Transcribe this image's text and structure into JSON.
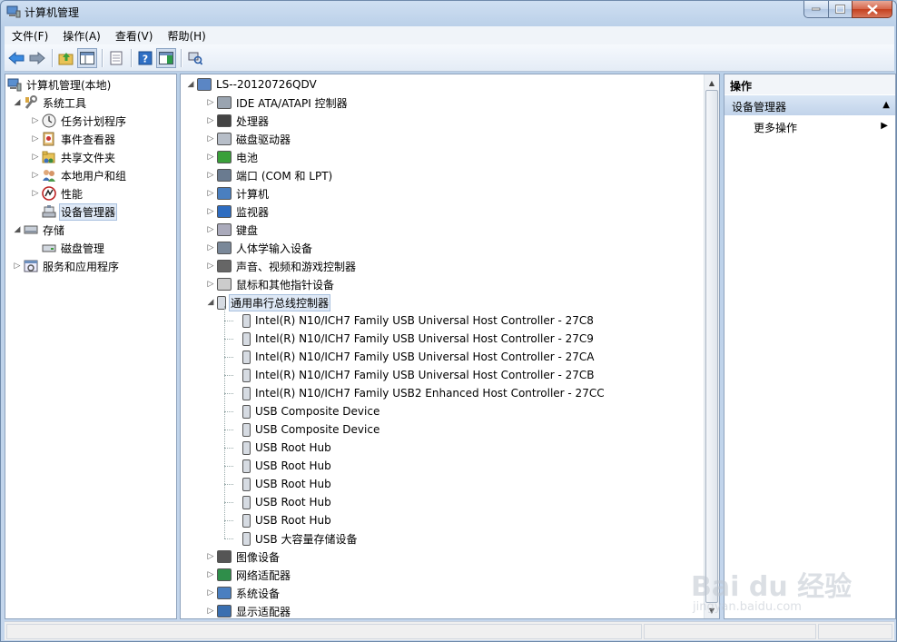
{
  "window": {
    "title": "计算机管理"
  },
  "menu": [
    {
      "label": "文件(F)"
    },
    {
      "label": "操作(A)"
    },
    {
      "label": "查看(V)"
    },
    {
      "label": "帮助(H)"
    }
  ],
  "left_tree": {
    "root": "计算机管理(本地)",
    "system_tools": "系统工具",
    "task_scheduler": "任务计划程序",
    "event_viewer": "事件查看器",
    "shared_folders": "共享文件夹",
    "local_users": "本地用户和组",
    "performance": "性能",
    "device_manager": "设备管理器",
    "storage": "存储",
    "disk_management": "磁盘管理",
    "services_apps": "服务和应用程序"
  },
  "device_tree": {
    "computer": "LS--20120726QDV",
    "categories": [
      {
        "label": "IDE ATA/ATAPI 控制器",
        "icon": "ide-controller-icon"
      },
      {
        "label": "处理器",
        "icon": "processor-icon"
      },
      {
        "label": "磁盘驱动器",
        "icon": "disk-drive-icon"
      },
      {
        "label": "电池",
        "icon": "battery-icon"
      },
      {
        "label": "端口 (COM 和 LPT)",
        "icon": "port-icon"
      },
      {
        "label": "计算机",
        "icon": "computer-icon"
      },
      {
        "label": "监视器",
        "icon": "monitor-icon"
      },
      {
        "label": "键盘",
        "icon": "keyboard-icon"
      },
      {
        "label": "人体学输入设备",
        "icon": "hid-icon"
      },
      {
        "label": "声音、视频和游戏控制器",
        "icon": "sound-icon"
      },
      {
        "label": "鼠标和其他指针设备",
        "icon": "mouse-icon"
      }
    ],
    "usb_category": "通用串行总线控制器",
    "usb_devices": [
      "Intel(R) N10/ICH7 Family USB Universal Host Controller - 27C8",
      "Intel(R) N10/ICH7 Family USB Universal Host Controller - 27C9",
      "Intel(R) N10/ICH7 Family USB Universal Host Controller - 27CA",
      "Intel(R) N10/ICH7 Family USB Universal Host Controller - 27CB",
      "Intel(R) N10/ICH7 Family USB2 Enhanced Host Controller - 27CC",
      "USB Composite Device",
      "USB Composite Device",
      "USB Root Hub",
      "USB Root Hub",
      "USB Root Hub",
      "USB Root Hub",
      "USB Root Hub",
      "USB 大容量存储设备"
    ],
    "after_categories": [
      {
        "label": "图像设备",
        "icon": "imaging-icon"
      },
      {
        "label": "网络适配器",
        "icon": "network-adapter-icon"
      },
      {
        "label": "系统设备",
        "icon": "system-device-icon"
      },
      {
        "label": "显示适配器",
        "icon": "display-adapter-icon"
      }
    ]
  },
  "actions": {
    "header": "操作",
    "section": "设备管理器",
    "more": "更多操作"
  },
  "watermark": {
    "brand": "Bai du 经验",
    "url": "jingyan.baidu.com"
  }
}
